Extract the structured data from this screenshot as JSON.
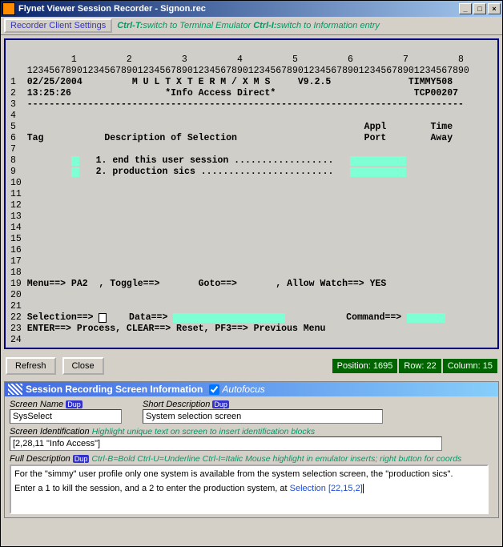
{
  "window": {
    "title": "Flynet Viewer Session Recorder - Signon.rec",
    "min": "_",
    "max": "□",
    "close": "×"
  },
  "toolbar": {
    "settings_btn": "Recorder Client Settings",
    "hint1": "Ctrl-T:",
    "hint1b": "switch to Terminal Emulator ",
    "hint2": "Ctrl-I:",
    "hint2b": "switch to Information entry"
  },
  "terminal": {
    "ruler_cols": "           1         2         3         4         5         6         7         8",
    "ruler_nums": "   12345678901234567890123456789012345678901234567890123456789012345678901234567890",
    "r01_ln": "1 ",
    "r01": " 02/25/2004         M U L T X T E R M / X M S     V9.2.5              TIMMY508",
    "r02_ln": "2 ",
    "r02": " 13:25:26                 *Info Access Direct*                         TCP00207",
    "r03_ln": "3 ",
    "r03": " -------------------------------------------------------------------------------",
    "r04_ln": "4 ",
    "r04": " ",
    "r05_ln": "5 ",
    "r05": "                                                              Appl        Time",
    "r06_ln": "6 ",
    "r06": " Tag           Description of Selection                       Port        Away",
    "r07_ln": "7 ",
    "r07": " ",
    "r08_ln": "8 ",
    "r08a": "         ",
    "r08b": "   1. end this user session ..................   ",
    "r09_ln": "9 ",
    "r09a": "         ",
    "r09b": "   2. production sics ........................   ",
    "r19_ln": "19",
    "r19": " Menu==> PA2  , Toggle==>       Goto==>       , Allow Watch==> YES",
    "r22_ln": "22",
    "r22a": " Selection==> ",
    "r22b": "    Data==> ",
    "r22c": "           Command==> ",
    "r23_ln": "23",
    "r23": " ENTER==> Process, CLEAR==> Reset, PF3==> Previous Menu"
  },
  "buttons": {
    "refresh": "Refresh",
    "close": "Close"
  },
  "status": {
    "pos": "Position: 1695",
    "row": "Row: 22",
    "col": "Column: 15"
  },
  "info": {
    "header": "Session Recording Screen Information",
    "autofocus": "Autofocus",
    "screen_name_lbl": "Screen Name",
    "screen_name_val": "SysSelect",
    "short_desc_lbl": "Short Description",
    "short_desc_val": "System selection screen",
    "screen_ident_lbl": "Screen Identification",
    "screen_ident_hint": "    Highlight unique text on screen to insert identification blocks",
    "screen_ident_val": "[2,28,11 \"Info Access\"]",
    "full_desc_lbl": "Full Description",
    "full_desc_hint": "   Ctrl-B=Bold Ctrl-U=Underline Ctrl-I=Italic  Mouse highlight in emulator inserts; right button for coords",
    "full_desc_line1": "For the \"simmy\" user profile only one system is available from the system selection screen, the \"production sics\".",
    "full_desc_line2a": "Enter a 1 to kill the session, and a 2 to enter the production system, at ",
    "full_desc_line2b": "Selection [22,15,2]",
    "dup": "Dup"
  }
}
